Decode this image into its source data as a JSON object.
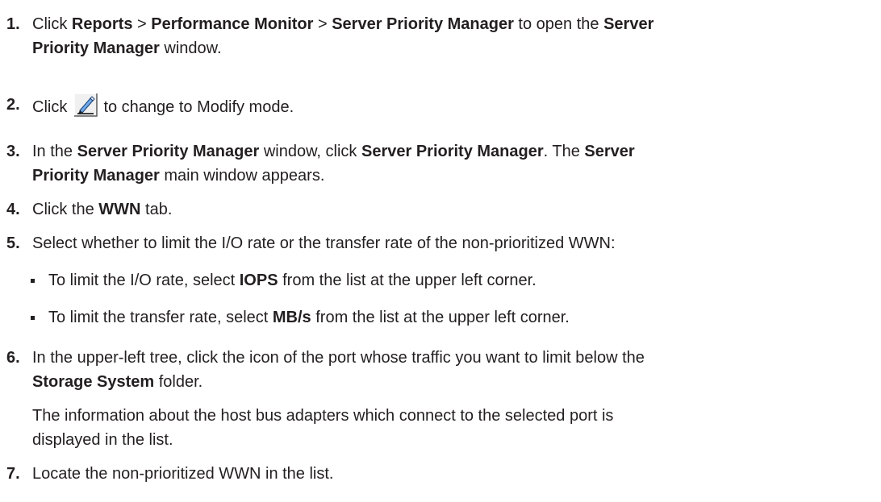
{
  "steps": [
    {
      "num": "1.",
      "p1": "Click ",
      "b1": "Reports",
      "p2": " > ",
      "b2": "Performance Monitor",
      "p3": " > ",
      "b3": "Server Priority Manager",
      "p4": " to open the ",
      "b4": "Server",
      "b5": "Priority Manager",
      "p5": " window."
    },
    {
      "num": "2.",
      "p1": "Click ",
      "icon": "modify-mode-icon",
      "p2": " to change to Modify mode."
    },
    {
      "num": "3.",
      "p1": "In the ",
      "b1": "Server Priority Manager",
      "p2": " window, click ",
      "b2": "Server Priority Manager",
      "p3": ". The ",
      "b3": "Server",
      "b4": "Priority Manager",
      "p4": " main window appears."
    },
    {
      "num": "4.",
      "p1": "Click the ",
      "b1": "WWN",
      "p2": " tab."
    },
    {
      "num": "5.",
      "p1": "Select whether to limit the I/O rate or the transfer rate of the non-prioritized WWN:",
      "bullets": [
        {
          "p1": "To limit the I/O rate, select ",
          "b1": "IOPS",
          "p2": " from the list at the upper left corner."
        },
        {
          "p1": "To limit the transfer rate, select ",
          "b1": "MB/s",
          "p2": " from the list at the upper left corner."
        }
      ]
    },
    {
      "num": "6.",
      "p1": "In the upper-left tree, click the icon of the port whose traffic you want to limit below the",
      "b1": "Storage System",
      "p2": " folder.",
      "note1": "The information about the host bus adapters which connect to the selected port is",
      "note2": "displayed in the list."
    },
    {
      "num": "7.",
      "p1": "Locate the non-prioritized WWN in the list."
    }
  ],
  "colors": {
    "text": "#231f20",
    "icon_bg": "#f0f0f0",
    "icon_pen": "#2a6fc9"
  }
}
